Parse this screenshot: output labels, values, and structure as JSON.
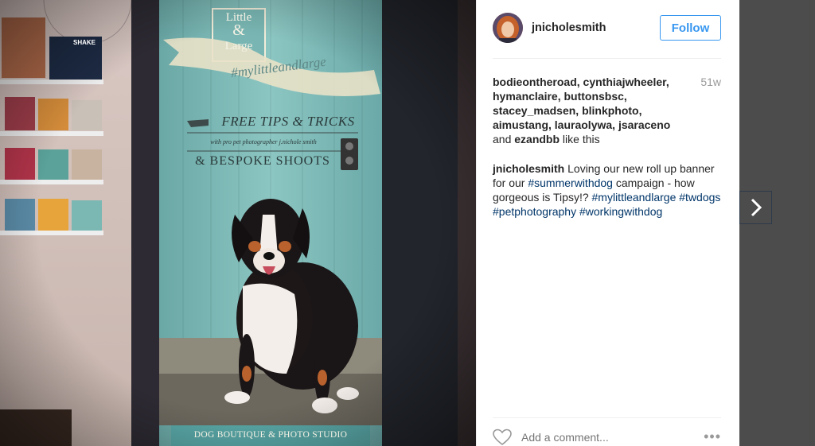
{
  "post": {
    "username": "jnicholesmith",
    "follow_label": "Follow",
    "age": "51w",
    "likes": {
      "names_line": "bodieontheroad, cynthiajwheeler, hymanclaire, buttonsbsc, stacey_madsen, blinkphoto, aimustang, lauraolywa, jsaraceno",
      "and_word": "and",
      "last_name": "ezandbb",
      "suffix": "like this"
    },
    "caption": {
      "author": "jnicholesmith",
      "text_1": "Loving our new roll up banner for our",
      "tag_1": "#summerwithdog",
      "text_2": "campaign - how gorgeous is Tipsy!?",
      "tag_2": "#mylittleandlarge",
      "tag_3": "#twdogs",
      "tag_4": "#petphotography",
      "tag_5": "#workingwithdog"
    },
    "comment_placeholder": "Add a comment...",
    "more_label": "•••"
  },
  "banner": {
    "logo_line_1": "Little",
    "logo_amp": "&",
    "logo_line_2": "Large",
    "hashtag": "#mylittleandlarge",
    "free_tips": "FREE TIPS & TRICKS",
    "with_photographer": "with pro pet photographer j.nichole smith",
    "bespoke": "& BESPOKE SHOOTS",
    "footer": "DOG BOUTIQUE & PHOTO STUDIO"
  },
  "shelf": {
    "book_label": "SHAKE"
  },
  "colors": {
    "banner_teal": "#7ab9b8",
    "follow_blue": "#3897f0",
    "hashtag_blue": "#003569",
    "backdrop": "#4c4c4c"
  },
  "icons": {
    "heart": "heart-icon",
    "next": "chevron-right-icon",
    "more": "more-options-icon"
  }
}
